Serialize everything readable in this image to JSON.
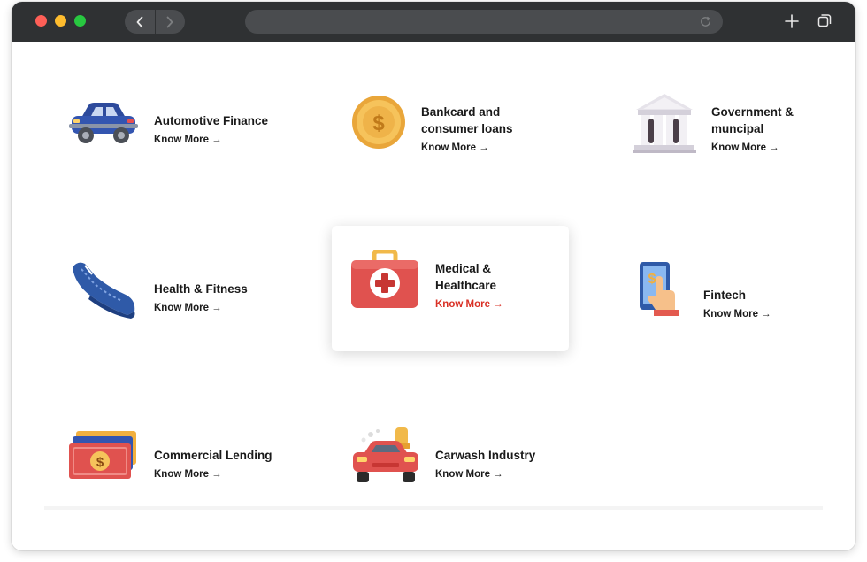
{
  "browser": {
    "buttons": [
      "close",
      "minimize",
      "zoom"
    ]
  },
  "industries": [
    {
      "title_line1": "Automotive Finance",
      "title_line2": "",
      "link": "Know More →"
    },
    {
      "title_line1": "Bankcard and",
      "title_line2": "consumer loans",
      "link": "Know More →"
    },
    {
      "title_line1": "Government &",
      "title_line2": "muncipal",
      "link": "Know More →"
    },
    {
      "title_line1": "Health & Fitness",
      "title_line2": "",
      "link": "Know More →"
    },
    {
      "title_line1": "Medical &",
      "title_line2": "Healthcare",
      "link": "Know More →",
      "active": true
    },
    {
      "title_line1": "Fintech",
      "title_line2": "",
      "link": "Know More →"
    },
    {
      "title_line1": "Commercial Lending",
      "title_line2": "",
      "link": "Know More →"
    },
    {
      "title_line1": "Carwash Industry",
      "title_line2": "",
      "link": "Know More →"
    }
  ],
  "icons": [
    "car-icon",
    "coin-icon",
    "bank-building-icon",
    "sneaker-icon",
    "first-aid-kit-icon",
    "phone-payment-icon",
    "cash-stack-icon",
    "carwash-icon"
  ],
  "colors": {
    "active_link": "#d93025",
    "text": "#1a1a1a",
    "titlebar": "#2f3133"
  }
}
